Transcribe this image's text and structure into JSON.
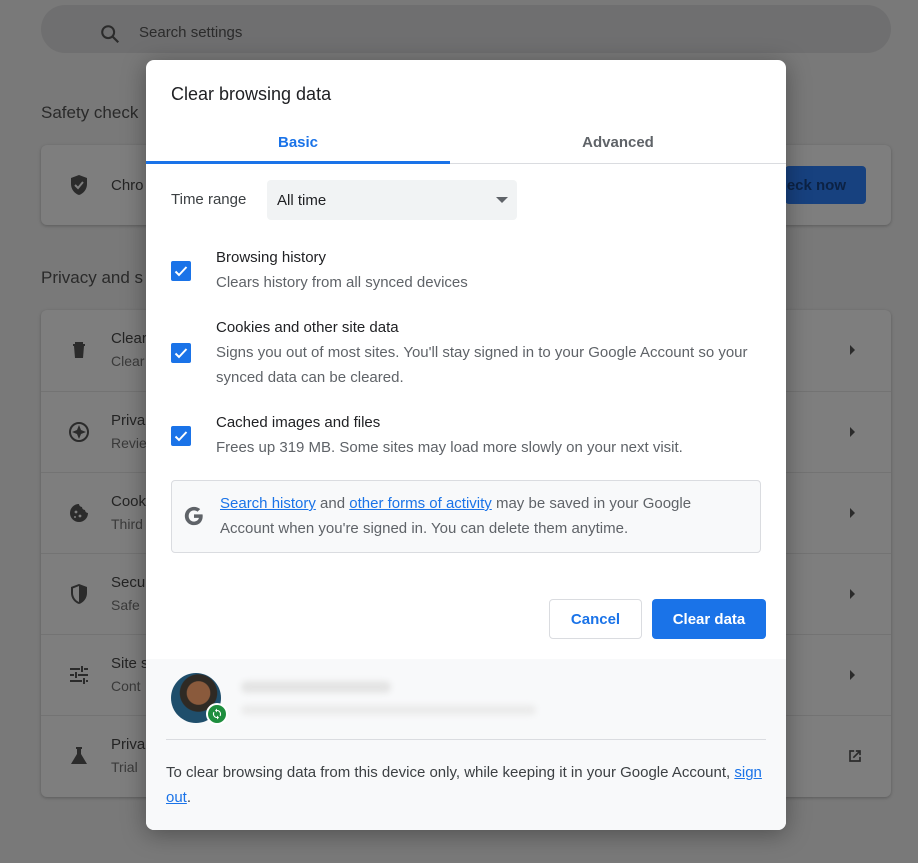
{
  "background": {
    "search_placeholder": "Search settings",
    "safety_check_title": "Safety check",
    "safety_row_text": "Chro",
    "check_now_label": "eck now",
    "privacy_title": "Privacy and s",
    "privacy_rows": [
      {
        "title": "Clear",
        "sub": "Clear"
      },
      {
        "title": "Priva",
        "sub": "Revie"
      },
      {
        "title": "Cook",
        "sub": "Third"
      },
      {
        "title": "Secu",
        "sub": "Safe"
      },
      {
        "title": "Site s",
        "sub": "Cont"
      },
      {
        "title": "Priva",
        "sub": "Trial"
      }
    ]
  },
  "dialog": {
    "title": "Clear browsing data",
    "tabs": [
      {
        "label": "Basic",
        "active": true
      },
      {
        "label": "Advanced",
        "active": false
      }
    ],
    "time_range": {
      "label": "Time range",
      "value": "All time"
    },
    "options": [
      {
        "title": "Browsing history",
        "desc": "Clears history from all synced devices",
        "checked": true
      },
      {
        "title": "Cookies and other site data",
        "desc": "Signs you out of most sites. You'll stay signed in to your Google Account so your synced data can be cleared.",
        "checked": true
      },
      {
        "title": "Cached images and files",
        "desc": "Frees up 319 MB. Some sites may load more slowly on your next visit.",
        "checked": true
      }
    ],
    "google_notice": {
      "link1": "Search history",
      "and": "and",
      "link2": "other forms of activity",
      "rest": "may be saved in your Google Account when you're signed in. You can delete them anytime."
    },
    "buttons": {
      "cancel": "Cancel",
      "clear": "Clear data"
    },
    "footer": {
      "text_before": "To clear browsing data from this device only, while keeping it in your Google Account,",
      "link": "sign out",
      "text_after": "."
    }
  },
  "colors": {
    "accent": "#1a73e8",
    "sync_badge": "#1e8e3e"
  }
}
